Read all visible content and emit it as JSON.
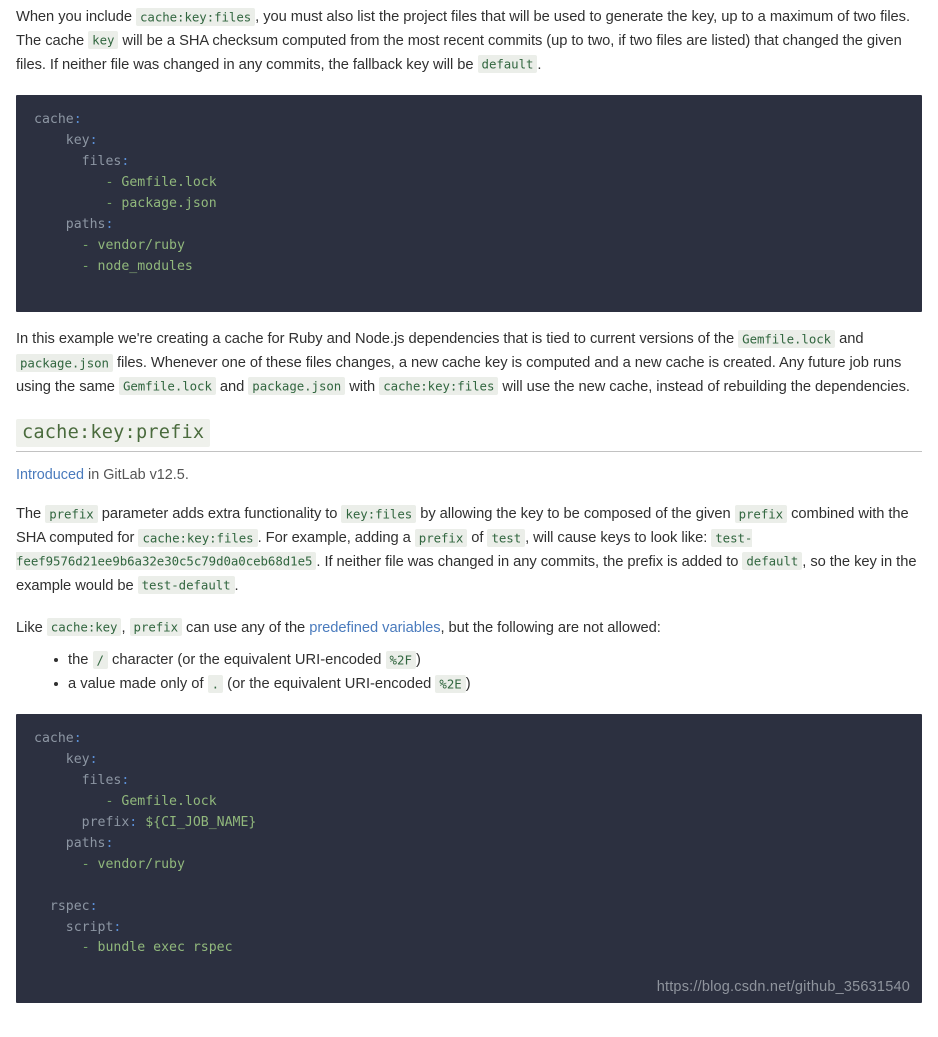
{
  "document": {
    "watermark": "https://blog.csdn.net/github_35631540"
  },
  "intro_paragraph": {
    "t1": "When you include ",
    "code1": "cache:key:files",
    "t2": ", you must also list the project files that will be used to generate the key, up to a maximum of two files. The cache ",
    "code2": "key",
    "t3": " will be a SHA checksum computed from the most recent commits (up to two, if two files are listed) that changed the given files. If neither file was changed in any commits, the fallback key will be ",
    "code3": "default",
    "t4": "."
  },
  "code_block_1": {
    "language": "yaml",
    "lines": [
      {
        "indent": 0,
        "key": "cache",
        "colon": ":",
        "value": ""
      },
      {
        "indent": 4,
        "key": "key",
        "colon": ":",
        "value": ""
      },
      {
        "indent": 6,
        "key": "files",
        "colon": ":",
        "value": ""
      },
      {
        "indent": 9,
        "dash": "-",
        "value": "Gemfile.lock"
      },
      {
        "indent": 9,
        "dash": "-",
        "value": "package.json"
      },
      {
        "indent": 4,
        "key": "paths",
        "colon": ":",
        "value": ""
      },
      {
        "indent": 6,
        "dash": "-",
        "value": "vendor/ruby"
      },
      {
        "indent": 6,
        "dash": "-",
        "value": "node_modules"
      }
    ],
    "raw": "cache:\n    key:\n      files:\n         - Gemfile.lock\n         - package.json\n    paths:\n      - vendor/ruby\n      - node_modules"
  },
  "example_paragraph": {
    "t1": "In this example we're creating a cache for Ruby and Node.js dependencies that is tied to current versions of the ",
    "code1": "Gemfile.lock",
    "t2": " and ",
    "code2": "package.json",
    "t3": " files. Whenever one of these files changes, a new cache key is computed and a new cache is created. Any future job runs using the same ",
    "code3": "Gemfile.lock",
    "t4": " and ",
    "code4": "package.json",
    "t5": " with ",
    "code5": "cache:key:files",
    "t6": " will use the new cache, instead of rebuilding the dependencies."
  },
  "heading": {
    "title": "cache:key:prefix"
  },
  "introduced": {
    "link_text": "Introduced",
    "rest": " in GitLab v12.5."
  },
  "prefix_paragraph": {
    "t1": "The ",
    "code1": "prefix",
    "t2": " parameter adds extra functionality to ",
    "code2": "key:files",
    "t3": " by allowing the key to be composed of the given ",
    "code3": "prefix",
    "t4": " combined with the SHA computed for ",
    "code4": "cache:key:files",
    "t5": ". For example, adding a ",
    "code5": "prefix",
    "t6": " of ",
    "code6": "test",
    "t7": ", will cause keys to look like: ",
    "code7": "test-feef9576d21ee9b6a32e30c5c79d0a0ceb68d1e5",
    "t8": ". If neither file was changed in any commits, the prefix is added to ",
    "code8": "default",
    "t9": ", so the key in the example would be ",
    "code9": "test-default",
    "t10": "."
  },
  "like_paragraph": {
    "t1": "Like ",
    "code1": "cache:key",
    "t2": ", ",
    "code2": "prefix",
    "t3": " can use any of the ",
    "link": "predefined variables",
    "t4": ", but the following are not allowed:"
  },
  "not_allowed_list": [
    {
      "t1": "the ",
      "code1": "/",
      "t2": " character (or the equivalent URI-encoded ",
      "code2": "%2F",
      "t3": ")"
    },
    {
      "t1": "a value made only of ",
      "code1": ".",
      "t2": " (or the equivalent URI-encoded ",
      "code2": "%2E",
      "t3": ")"
    }
  ],
  "code_block_2": {
    "language": "yaml",
    "lines": [
      {
        "indent": 0,
        "key": "cache",
        "colon": ":",
        "value": ""
      },
      {
        "indent": 4,
        "key": "key",
        "colon": ":",
        "value": ""
      },
      {
        "indent": 6,
        "key": "files",
        "colon": ":",
        "value": ""
      },
      {
        "indent": 9,
        "dash": "-",
        "value": "Gemfile.lock"
      },
      {
        "indent": 6,
        "key": "prefix",
        "colon": ":",
        "value": "${CI_JOB_NAME}"
      },
      {
        "indent": 4,
        "key": "paths",
        "colon": ":",
        "value": ""
      },
      {
        "indent": 6,
        "dash": "-",
        "value": "vendor/ruby"
      },
      {
        "indent": 0,
        "blank": true
      },
      {
        "indent": 2,
        "key": "rspec",
        "colon": ":",
        "value": ""
      },
      {
        "indent": 4,
        "key": "script",
        "colon": ":",
        "value": ""
      },
      {
        "indent": 6,
        "dash": "-",
        "value": "bundle exec rspec"
      }
    ],
    "raw": "cache:\n    key:\n      files:\n         - Gemfile.lock\n      prefix: ${CI_JOB_NAME}\n    paths:\n      - vendor/ruby\n\n  rspec:\n    script:\n      - bundle exec rspec"
  },
  "colors": {
    "code_background": "#2c3040",
    "yaml_key": "#8d96a3",
    "yaml_punctuation": "#5b8fd6",
    "yaml_value": "#91b87c",
    "inline_code_text": "#31663f",
    "inline_code_background": "#ebeee9",
    "link": "#4a7bbd",
    "body_text": "#303030",
    "watermark": "#8f949d"
  }
}
